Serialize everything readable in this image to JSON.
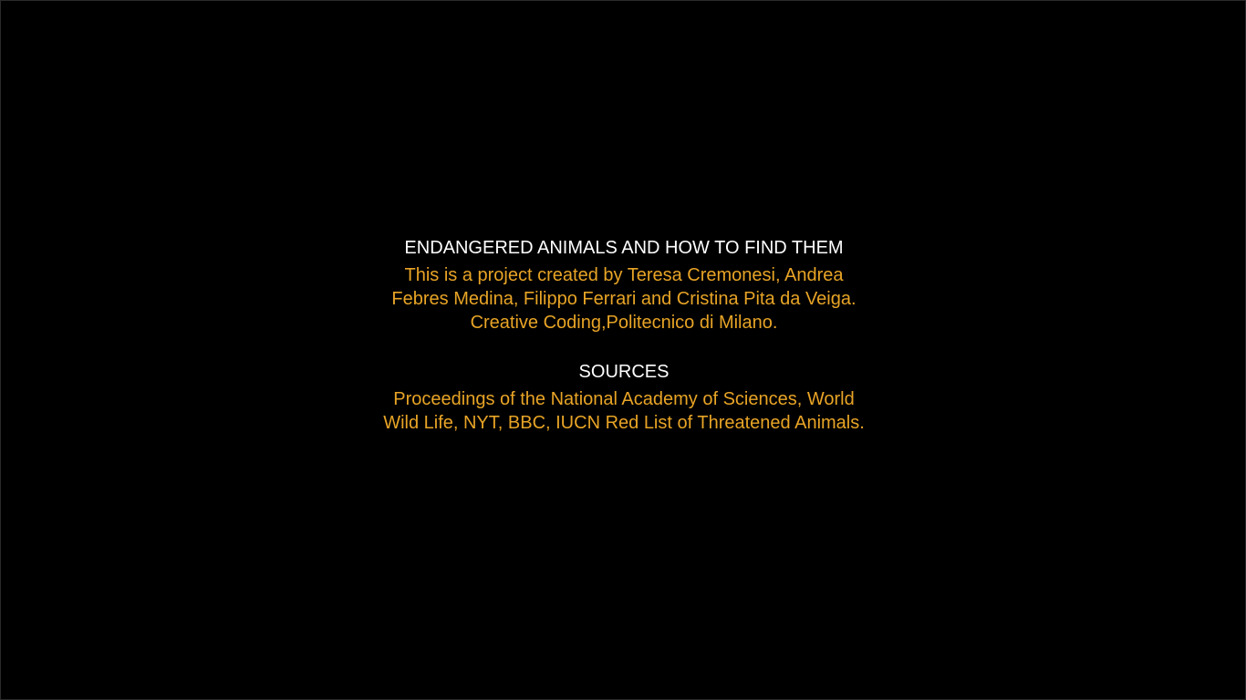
{
  "about": {
    "title": "ENDANGERED ANIMALS AND HOW TO FIND THEM",
    "lines": [
      "This is a project created by Teresa Cremonesi, Andrea",
      "Febres Medina, Filippo Ferrari and Cristina Pita da Veiga.",
      "Creative Coding,Politecnico di Milano."
    ]
  },
  "sources": {
    "title": "SOURCES",
    "lines": [
      "Proceedings of the National Academy of Sciences, World",
      "Wild Life, NYT, BBC, IUCN Red List of Threatened Animals."
    ]
  },
  "colors": {
    "background": "#000000",
    "heading": "#ffffff",
    "body": "#e8a426"
  }
}
